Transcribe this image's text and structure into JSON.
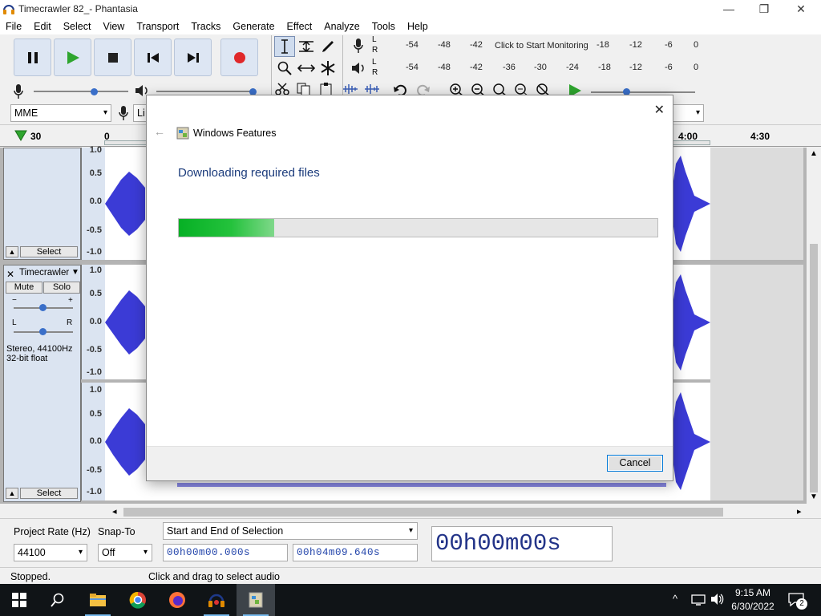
{
  "window": {
    "title": "Timecrawler 82_- Phantasia",
    "minimize": "—",
    "maximize": "❐",
    "close": "✕"
  },
  "menu": [
    "File",
    "Edit",
    "Select",
    "View",
    "Transport",
    "Tracks",
    "Generate",
    "Effect",
    "Analyze",
    "Tools",
    "Help"
  ],
  "meters": {
    "record_scale": [
      "-54",
      "-48",
      "-42",
      "-18",
      "-12",
      "-6",
      "0"
    ],
    "monitor_label": "Click to Start Monitoring",
    "play_scale": [
      "-54",
      "-48",
      "-42",
      "-36",
      "-30",
      "-24",
      "-18",
      "-12",
      "-6",
      "0"
    ],
    "lr": [
      "L",
      "R"
    ]
  },
  "device": {
    "host": "MME",
    "input_partial": "Li"
  },
  "timeline": {
    "ticks": [
      "30",
      "0",
      "4:00",
      "4:30"
    ]
  },
  "track1": {
    "scale": [
      "1.0",
      "0.5",
      "0.0",
      "-0.5",
      "-1.0"
    ],
    "select_label": "Select"
  },
  "track2": {
    "name": "Timecrawler",
    "mute": "Mute",
    "solo": "Solo",
    "pan_l": "L",
    "pan_r": "R",
    "gain_minus": "−",
    "gain_plus": "+",
    "info1": "Stereo, 44100Hz",
    "info2": "32-bit float",
    "scale_a": [
      "1.0",
      "0.5",
      "0.0",
      "-0.5",
      "-1.0"
    ],
    "scale_b": [
      "1.0",
      "0.5",
      "0.0",
      "-0.5",
      "-1.0"
    ],
    "select_label": "Select"
  },
  "dialog": {
    "title": "Windows Features",
    "heading": "Downloading required files",
    "progress_fraction": 0.2,
    "cancel": "Cancel"
  },
  "selection_toolbar": {
    "project_rate_label": "Project Rate (Hz)",
    "snap_label": "Snap-To",
    "selection_mode": "Start and End of Selection",
    "rate_value": "44100",
    "snap_value": "Off",
    "start_time": "00h00m00.000s",
    "end_time": "00h04m09.640s",
    "big_time": "00h00m00s"
  },
  "status": {
    "left": "Stopped.",
    "right": "Click and drag to select audio"
  },
  "taskbar": {
    "time": "9:15 AM",
    "date": "6/30/2022",
    "notifications": "2"
  },
  "colors": {
    "accent": "#0078d7",
    "progress": "#06b025",
    "waveform": "#3b3bd6",
    "track_bg": "#dbe4f1"
  }
}
